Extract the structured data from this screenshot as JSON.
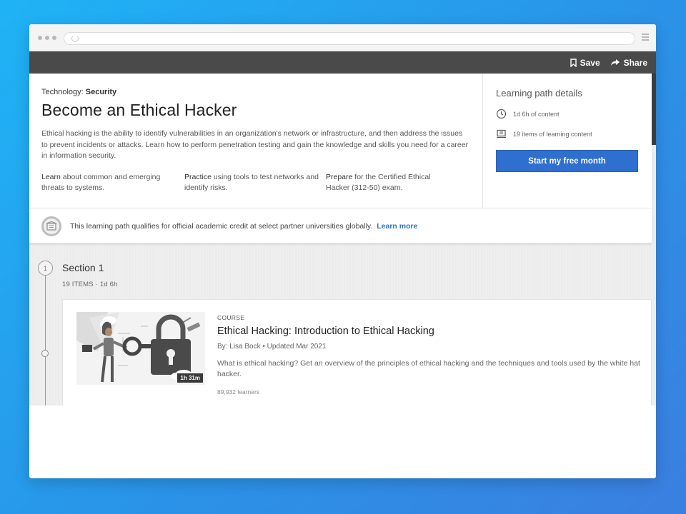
{
  "toolbar": {
    "save_label": "Save",
    "share_label": "Share"
  },
  "hero": {
    "category_prefix": "Technology: ",
    "category": "Security",
    "title": "Become an Ethical Hacker",
    "description": "Ethical hacking is the ability to identify vulnerabilities in an organization's network or infrastructure, and then address the issues to prevent incidents or attacks. Learn how to perform penetration testing and gain the knowledge and skills you need for a career in information security.",
    "points": [
      {
        "lead": "Learn",
        "text": " about common and emerging threats to systems."
      },
      {
        "lead": "Practice",
        "text": " using tools to test networks and identify risks."
      },
      {
        "lead": "Prepare",
        "text": " for the Certified Ethical Hacker (312-50) exam."
      }
    ]
  },
  "details": {
    "title": "Learning path details",
    "duration": "1d 6h of content",
    "items": "19 items of learning content",
    "cta": "Start my free month"
  },
  "credit": {
    "text": "This learning path qualifies for official academic credit at select partner universities globally.",
    "link": "Learn more"
  },
  "section": {
    "number": "1",
    "title": "Section 1",
    "meta": "19 ITEMS  ·  1d 6h"
  },
  "course": {
    "type": "COURSE",
    "title": "Ethical Hacking: Introduction to Ethical Hacking",
    "byline": "By: Lisa Bock  •  Updated Mar 2021",
    "description": "What is ethical hacking? Get an overview of the principles of ethical hacking and the techniques and tools used by the white hat hacker.",
    "learners": "89,932 learners",
    "duration": "1h 31m"
  }
}
